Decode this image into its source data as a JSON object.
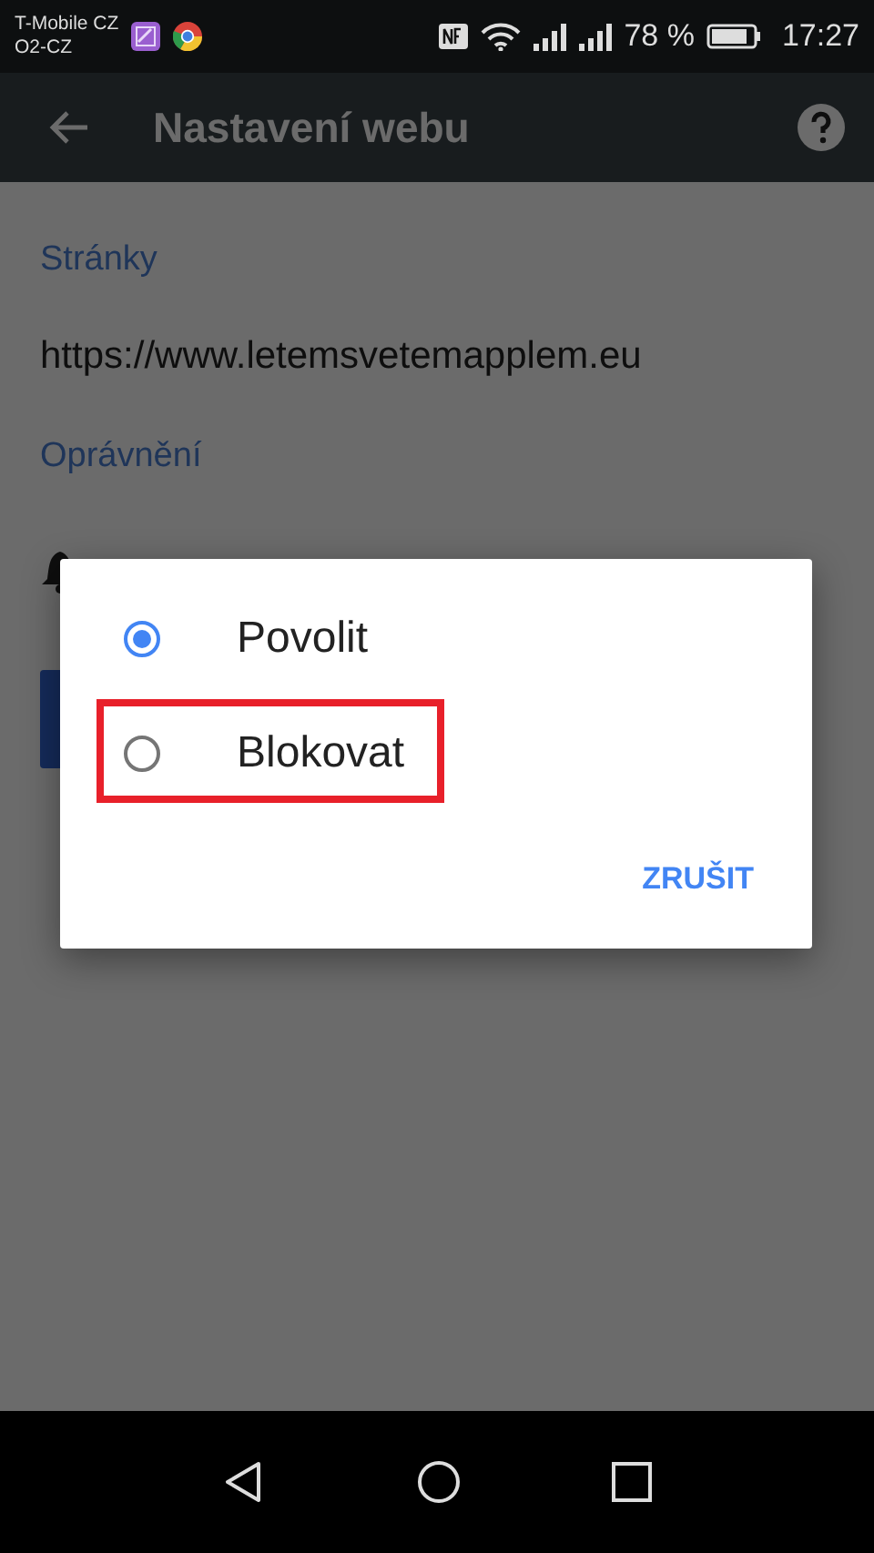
{
  "status_bar": {
    "carriers": [
      "T-Mobile CZ",
      "O2-CZ"
    ],
    "battery": "78 %",
    "time": "17:27"
  },
  "app_bar": {
    "title": "Nastavení webu"
  },
  "sections": [
    {
      "heading": "Stránky",
      "text": "https://www.letemsvetemapplem.eu"
    },
    {
      "heading": "Oprávnění"
    }
  ],
  "dialog": {
    "options": [
      {
        "label": "Povolit",
        "selected": true,
        "highlighted": false
      },
      {
        "label": "Blokovat",
        "selected": false,
        "highlighted": true
      }
    ],
    "cancel": "ZRUŠIT"
  }
}
